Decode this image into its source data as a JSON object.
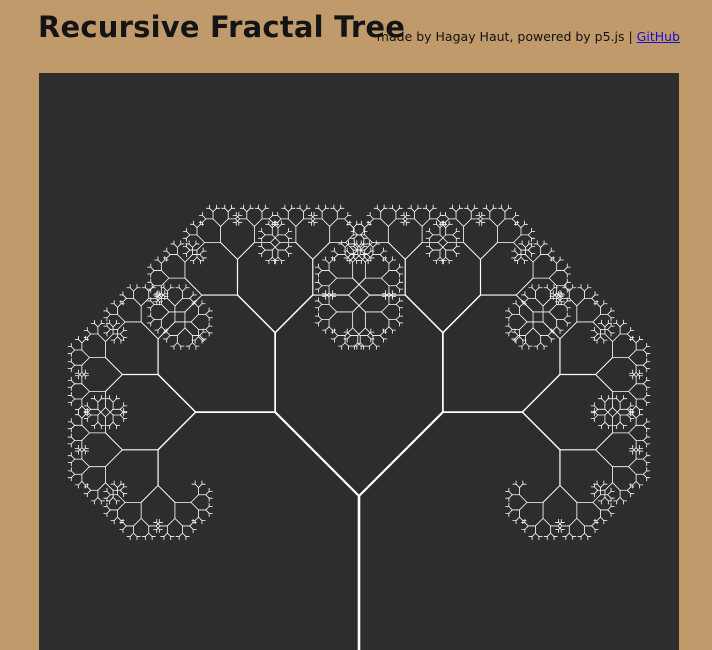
{
  "header": {
    "title": "Recursive Fractal Tree",
    "credits_prefix": "made by Hagay Haut, powered by p5.js | ",
    "github_link": "GitHub"
  },
  "colors": {
    "page_background": "#c19a6b",
    "canvas_background": "#2d2d2d",
    "branch": "#ffffff",
    "title_text": "#141414",
    "link": "#1a0dcc"
  }
}
